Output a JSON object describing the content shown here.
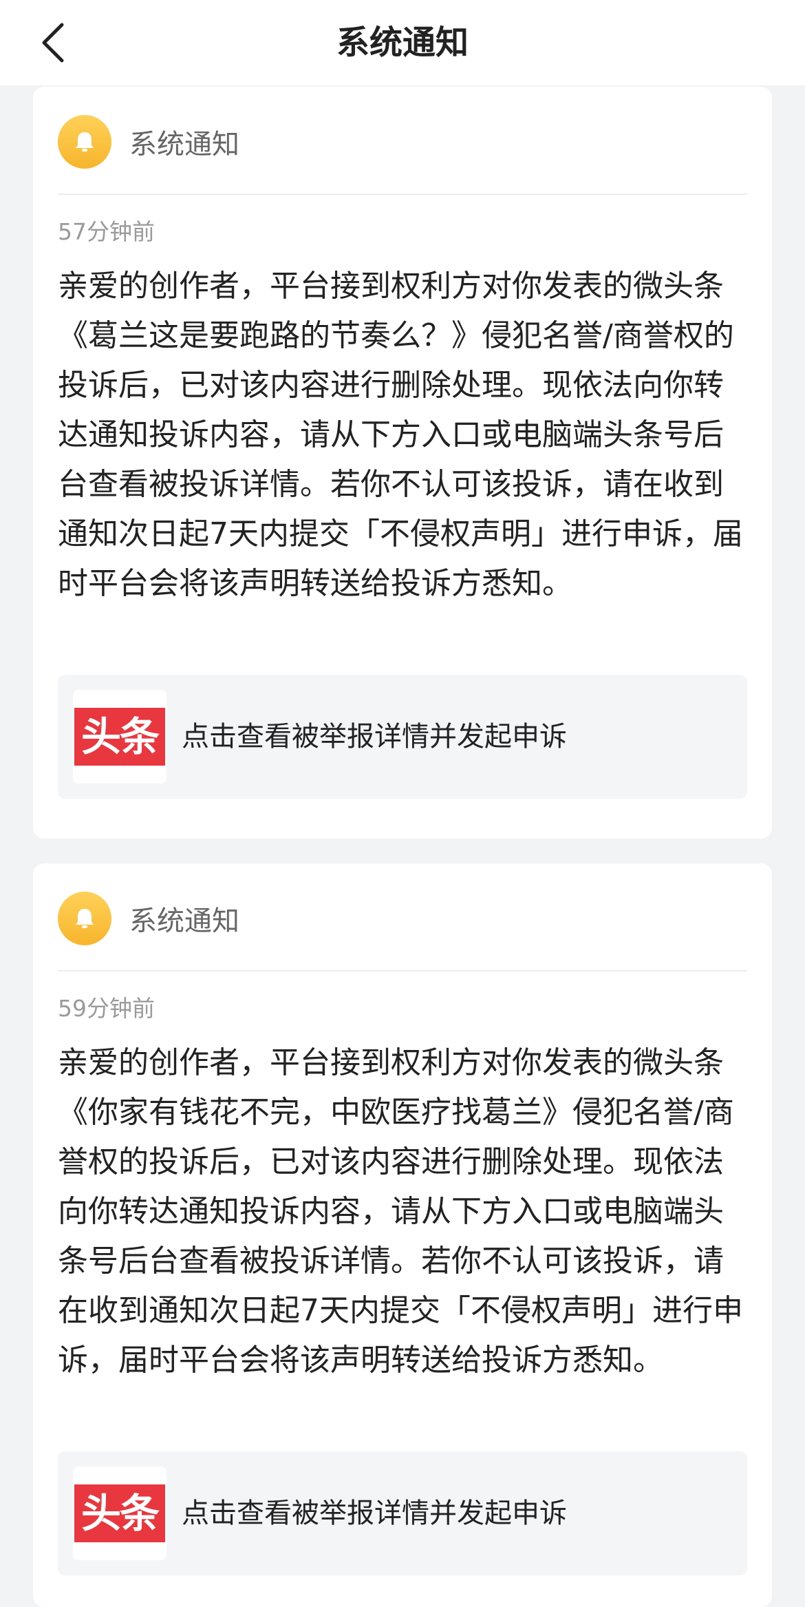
{
  "header": {
    "title": "系统通知",
    "back_icon": "chevron-left-icon"
  },
  "notifications": [
    {
      "icon": "bell-icon",
      "sender": "系统通知",
      "time": "57分钟前",
      "body": "亲爱的创作者，平台接到权利方对你发表的微头条《葛兰这是要跑路的节奏么？》侵犯名誉/商誉权的投诉后，已对该内容进行删除处理。现依法向你转达通知投诉内容，请从下方入口或电脑端头条号后台查看被投诉详情。若你不认可该投诉，请在收到通知次日起7天内提交「不侵权声明」进行申诉，届时平台会将该声明转送给投诉方悉知。",
      "link": {
        "logo_text": "头条",
        "label": "点击查看被举报详情并发起申诉"
      }
    },
    {
      "icon": "bell-icon",
      "sender": "系统通知",
      "time": "59分钟前",
      "body": "亲爱的创作者，平台接到权利方对你发表的微头条《你家有钱花不完，中欧医疗找葛兰》侵犯名誉/商誉权的投诉后，已对该内容进行删除处理。现依法向你转达通知投诉内容，请从下方入口或电脑端头条号后台查看被投诉详情。若你不认可该投诉，请在收到通知次日起7天内提交「不侵权声明」进行申诉，届时平台会将该声明转送给投诉方悉知。",
      "link": {
        "logo_text": "头条",
        "label": "点击查看被举报详情并发起申诉"
      }
    }
  ],
  "colors": {
    "page_background": "#f2f3f5",
    "bell": "#f7b52c",
    "logo": "#e8373e"
  }
}
